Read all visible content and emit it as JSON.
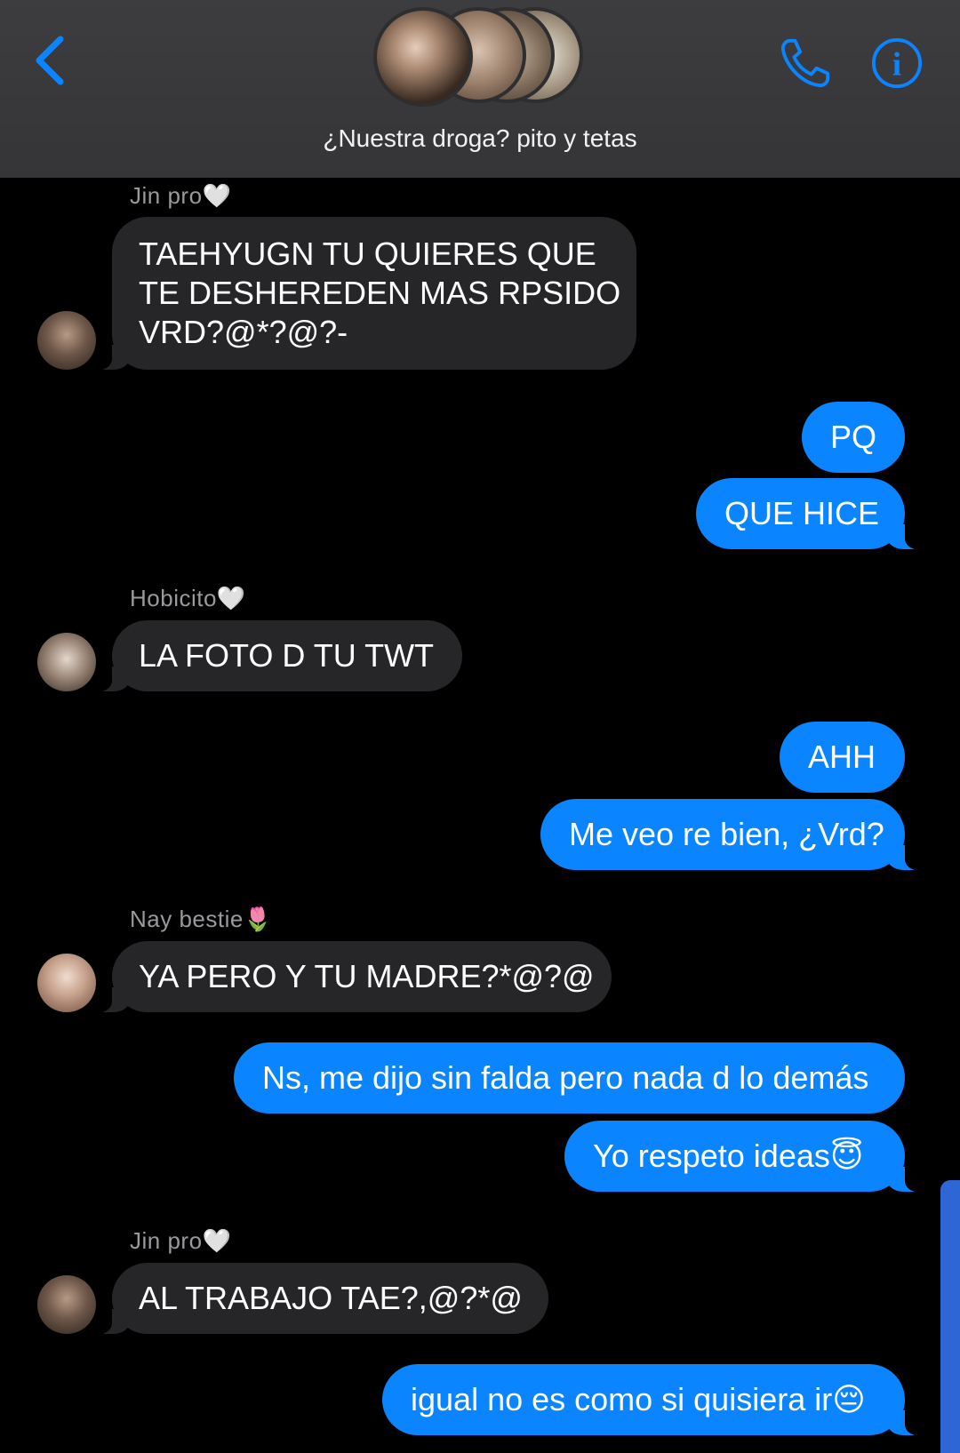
{
  "header": {
    "group_name": "¿Nuestra droga? pito y tetas",
    "back_icon": "chevron-left-icon",
    "call_icon": "phone-icon",
    "info_icon": "info-icon",
    "info_glyph": "i",
    "accent_color": "#0a84ff"
  },
  "messages": [
    {
      "sender": "Jin pro🤍",
      "text": "TAEHYUGN TU QUIERES QUE",
      "text2": "TE DESHEREDEN MAS RPSIDO",
      "text3": "VRD?@*?@?-"
    },
    {
      "text": "PQ"
    },
    {
      "text": "QUE HICE"
    },
    {
      "sender": "Hobicito🤍",
      "text": "LA FOTO D TU TWT"
    },
    {
      "text": "AHH"
    },
    {
      "text": "Me veo re bien, ¿Vrd?"
    },
    {
      "sender": "Nay bestie🌷",
      "text": "YA PERO Y TU MADRE?*@?@"
    },
    {
      "text": "Ns, me dijo sin falda pero nada d lo demás"
    },
    {
      "text": "Yo respeto ideas😇"
    },
    {
      "sender": "Jin pro🤍",
      "text": "AL TRABAJO TAE?,@?*@"
    },
    {
      "text": "igual no es como si quisiera ir😔"
    }
  ]
}
